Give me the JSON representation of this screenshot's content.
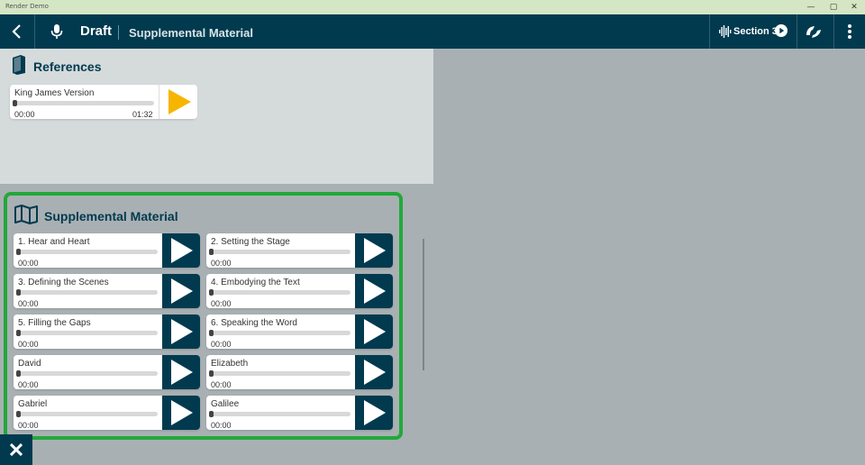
{
  "window": {
    "title": "Render Demo",
    "minimize": "—",
    "maximize": "▢",
    "close": "✕"
  },
  "appbar": {
    "back_icon": "chevron-left-icon",
    "mic_icon": "microphone-icon",
    "mode": "Draft",
    "page_title": "Supplemental Material",
    "section_label": "Section 3",
    "section_icons": [
      "waveform-icon",
      "play-circle-icon"
    ],
    "logo_icon": "render-logo-icon",
    "menu_icon": "kebab-menu-icon"
  },
  "references": {
    "heading": "References",
    "icon": "book-icon",
    "items": [
      {
        "name": "King James Version",
        "time": "00:00",
        "duration": "01:32",
        "progress": 0,
        "accent": "#f7b500"
      }
    ]
  },
  "supplemental": {
    "heading": "Supplemental Material",
    "icon": "map-icon",
    "border_color": "#22a83a",
    "items": [
      {
        "name": "1. Hear and Heart",
        "time": "00:00",
        "progress": 0
      },
      {
        "name": "2. Setting the Stage",
        "time": "00:00",
        "progress": 0
      },
      {
        "name": "3. Defining the Scenes",
        "time": "00:00",
        "progress": 0
      },
      {
        "name": "4. Embodying the Text",
        "time": "00:00",
        "progress": 0
      },
      {
        "name": "5. Filling the Gaps",
        "time": "00:00",
        "progress": 0
      },
      {
        "name": "6. Speaking the Word",
        "time": "00:00",
        "progress": 0
      },
      {
        "name": "David",
        "time": "00:00",
        "progress": 0
      },
      {
        "name": "Elizabeth",
        "time": "00:00",
        "progress": 0
      },
      {
        "name": "Gabriel",
        "time": "00:00",
        "progress": 0
      },
      {
        "name": "Galilee",
        "time": "00:00",
        "progress": 0
      }
    ]
  },
  "close_icon": "close-x-icon",
  "colors": {
    "primary": "#013a4f",
    "background": "#a9b0b3",
    "panel": "#d5dadb"
  }
}
